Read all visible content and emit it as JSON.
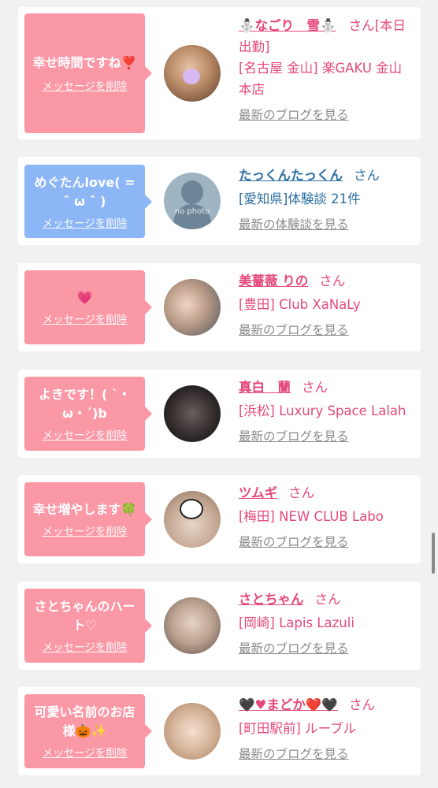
{
  "entries": [
    {
      "bubble_msg": "幸せ時間ですね❣️",
      "delete_label": "メッセージを削除",
      "name": "⛄なごり　雪⛄",
      "honorific": "さん",
      "status": "[本日出勤]",
      "shop": "[名古屋 金山] 楽GAKU 金山本店",
      "more_link": "最新のブログを見る"
    },
    {
      "bubble_msg": "めぐたんlove( = ˆ ω ˆ )",
      "delete_label": "メッセージを削除",
      "name": "たっくんたっくん",
      "honorific": "さん",
      "shop": "[愛知県]体験談 21件",
      "more_link": "最新の体験談を見る",
      "avatar_caption": "no photo"
    },
    {
      "bubble_msg": "💗",
      "delete_label": "メッセージを削除",
      "name": "美薔薇 りの",
      "honorific": "さん",
      "shop": "[豊田] Club XaNaLy",
      "more_link": "最新のブログを見る"
    },
    {
      "bubble_msg": "よきです！( ˋ・ω・ˊ)b",
      "delete_label": "メッセージを削除",
      "name": "真白　蘭",
      "honorific": "さん",
      "shop": "[浜松] Luxury Space Lalah",
      "more_link": "最新のブログを見る"
    },
    {
      "bubble_msg": "幸せ増やします🍀",
      "delete_label": "メッセージを削除",
      "name": "ツムギ",
      "honorific": "さん",
      "shop": "[梅田] NEW CLUB Labo",
      "more_link": "最新のブログを見る"
    },
    {
      "bubble_msg": "さとちゃんのハート♡",
      "delete_label": "メッセージを削除",
      "name": "さとちゃん",
      "honorific": "さん",
      "shop": "[岡崎] Lapis Lazuli",
      "more_link": "最新のブログを見る"
    },
    {
      "bubble_msg": "可愛い名前のお店様🎃✨",
      "delete_label": "メッセージを削除",
      "name": "🖤♥まどか❤️🖤",
      "honorific": "さん",
      "shop": "[町田駅前] ルーブル",
      "more_link": "最新のブログを見る"
    }
  ]
}
